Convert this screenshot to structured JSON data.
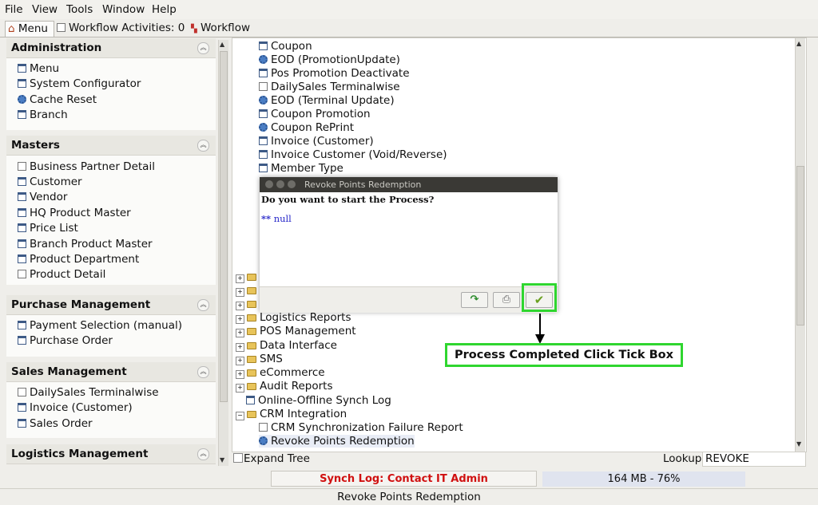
{
  "menu": [
    "File",
    "View",
    "Tools",
    "Window",
    "Help"
  ],
  "tabs": [
    "Menu",
    "Workflow Activities: 0",
    "Workflow"
  ],
  "groups": [
    {
      "title": "Administration",
      "items": [
        "Menu",
        "System Configurator",
        "Cache Reset",
        "Branch"
      ]
    },
    {
      "title": "Masters",
      "items": [
        "Business Partner Detail",
        "Customer",
        "Vendor",
        "HQ Product Master",
        "Price List",
        "Branch Product Master",
        "Product Department",
        "Product Detail"
      ]
    },
    {
      "title": "Purchase Management",
      "items": [
        "Payment Selection (manual)",
        "Purchase Order"
      ]
    },
    {
      "title": "Sales Management",
      "items": [
        "DailySales Terminalwise",
        "Invoice (Customer)",
        "Sales Order"
      ]
    },
    {
      "title": "Logistics Management",
      "items": []
    }
  ],
  "tree": {
    "top_items": [
      "Coupon",
      "EOD (PromotionUpdate)",
      "Pos Promotion Deactivate",
      "DailySales Terminalwise",
      "EOD (Terminal Update)",
      "Coupon Promotion",
      "Coupon RePrint",
      "Invoice (Customer)",
      "Invoice Customer (Void/Reverse)",
      "Member Type"
    ],
    "folders": [
      "Logistics Reports",
      "POS Management",
      "Data Interface",
      "SMS",
      "eCommerce",
      "Audit Reports"
    ],
    "synch_log": "Online-Offline Synch Log",
    "crm_folder": "CRM Integration",
    "crm_items": [
      "CRM Synchronization Failure Report",
      "Revoke Points Redemption"
    ]
  },
  "expand_tree_label": "Expand Tree",
  "lookup_label": "Lookup",
  "lookup_value": "REVOKE",
  "dialog": {
    "title": "Revoke Points Redemption",
    "question": "Do you want to start the Process?",
    "info_prefix": "**",
    "info": "null"
  },
  "callout": "Process Completed Click Tick Box",
  "status": {
    "synch": "Synch Log: Contact IT Admin",
    "memory": "164 MB - 76%",
    "bottom": "Revoke Points Redemption"
  },
  "colors": {
    "highlight": "#2fd62f",
    "warning": "#d01010",
    "link": "#2727c9"
  }
}
